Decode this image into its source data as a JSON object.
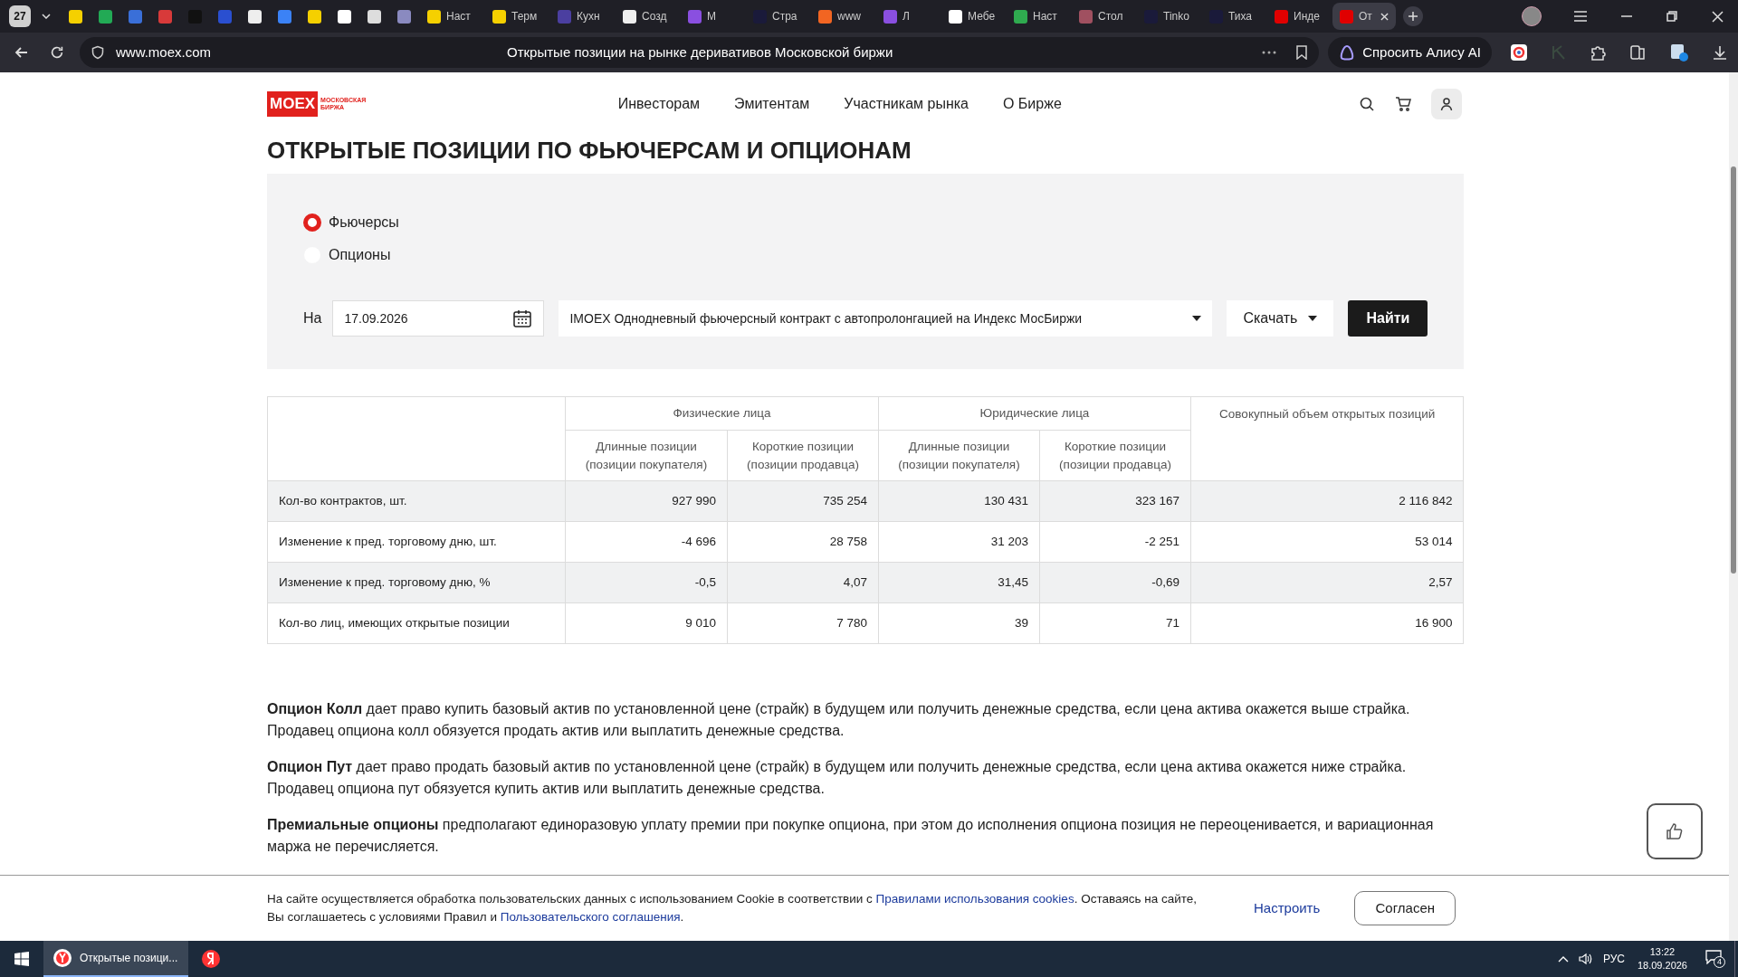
{
  "browser": {
    "tab_count": "27",
    "tabs": [
      {
        "color": "#f5d000",
        "selected": false
      },
      {
        "color": "#22aa55",
        "selected": false
      },
      {
        "color": "#3a6fd8",
        "selected": false
      },
      {
        "color": "#d83a3a",
        "selected": false
      },
      {
        "color": "#111111",
        "selected": false
      },
      {
        "color": "#2a4fd0",
        "selected": false
      },
      {
        "color": "#eeeeee",
        "selected": false
      },
      {
        "color": "#3b82f6",
        "selected": false
      },
      {
        "color": "#f5d000",
        "selected": false
      },
      {
        "color": "#ffffff",
        "selected": false
      },
      {
        "color": "#dddddd",
        "selected": false
      },
      {
        "color": "#8a8ac0",
        "selected": false
      },
      {
        "label": "Наст",
        "color": "#f5d000",
        "selected": false
      },
      {
        "label": "Терм",
        "color": "#f5d000",
        "selected": false
      },
      {
        "label": "Кухн",
        "color": "#4b3fa0",
        "selected": false
      },
      {
        "label": "Созд",
        "color": "#eeeeee",
        "selected": false
      },
      {
        "label": "М",
        "color": "#8a4fe0",
        "selected": false
      },
      {
        "label": "Стра",
        "color": "#1a1a3a",
        "selected": false
      },
      {
        "label": "www",
        "color": "#f26522",
        "selected": false
      },
      {
        "label": "Л",
        "color": "#8a4fe0",
        "selected": false
      },
      {
        "label": "Мебе",
        "color": "#ffffff",
        "selected": false
      },
      {
        "label": "Наст",
        "color": "#2faa4f",
        "selected": false
      },
      {
        "label": "Стол",
        "color": "#a05060",
        "selected": false
      },
      {
        "label": "Tinko",
        "color": "#1a1a3a",
        "selected": false
      },
      {
        "label": "Тиха",
        "color": "#1a1a3a",
        "selected": false
      },
      {
        "label": "Инде",
        "color": "#e00000",
        "selected": false
      },
      {
        "label": "От",
        "color": "#e00000",
        "selected": true
      }
    ],
    "address": "www.moex.com",
    "page_title": "Открытые позиции на рынке деривативов Московской биржи",
    "assistant_button": "Спросить Алису AI"
  },
  "site": {
    "logo": "MOEX",
    "logo_caption": "МОСКОВСКАЯ БИРЖА",
    "nav": [
      "Инвесторам",
      "Эмитентам",
      "Участникам рынка",
      "О Бирже"
    ]
  },
  "heading": "ОТКРЫТЫЕ ПОЗИЦИИ ПО ФЬЮЧЕРСАМ И ОПЦИОНАМ",
  "filter": {
    "types": [
      {
        "label": "Фьючерсы",
        "selected": true
      },
      {
        "label": "Опционы",
        "selected": false
      }
    ],
    "date_label": "На",
    "date": "17.09.2026",
    "contract": "IMOEX Однодневный фьючерсный контракт с автопролонгацией на Индекс МосБиржи",
    "download": "Скачать",
    "search": "Найти"
  },
  "table": {
    "groups": [
      "Физические лица",
      "Юридические лица",
      "Совокупный объем открытых позиций"
    ],
    "subcolumns": [
      "Длинные позиции (позиции покупателя)",
      "Короткие позиции (позиции продавца)",
      "Длинные позиции (позиции покупателя)",
      "Короткие позиции (позиции продавца)"
    ],
    "rows": [
      [
        "Кол-во контрактов, шт.",
        "927 990",
        "735 254",
        "130 431",
        "323 167",
        "2 116 842"
      ],
      [
        "Изменение к пред. торговому дню, шт.",
        "-4 696",
        "28 758",
        "31 203",
        "-2 251",
        "53 014"
      ],
      [
        "Изменение к пред. торговому дню, %",
        "-0,5",
        "4,07",
        "31,45",
        "-0,69",
        "2,57"
      ],
      [
        "Кол-во лиц, имеющих открытые позиции",
        "9 010",
        "7 780",
        "39",
        "71",
        "16 900"
      ]
    ]
  },
  "paragraphs": [
    "**Опцион Колл** дает право купить базовый актив по установленной цене (страйк) в будущем или получить денежные средства, если цена актива окажется выше страйка. Продавец опциона колл обязуется продать актив или выплатить денежные средства.",
    "**Опцион Пут** дает право продать базовый актив по установленной цене (страйк) в будущем или получить денежные средства, если цена актива окажется ниже страйка. Продавец опциона пут обязуется купить актив или выплатить денежные средства.",
    "**Премиальные опционы** предполагают единоразовую уплату премии при покупке опциона, при этом до исполнения опциона позиция не переоценивается, и вариационная маржа не перечисляется."
  ],
  "cookie": {
    "parts": [
      {
        "kind": "text",
        "text": "На сайте осуществляется обработка пользовательских данных с использованием Cookie в соответствии с "
      },
      {
        "kind": "link",
        "text": "Правилами использования cookies"
      },
      {
        "kind": "text",
        "text": ". Оставаясь на сайте, Вы соглашаетесь с условиями Правил и "
      },
      {
        "kind": "link",
        "text": "Пользовательского соглашения"
      },
      {
        "kind": "text",
        "text": "."
      }
    ],
    "settings": "Настроить",
    "accept": "Согласен"
  },
  "taskbar": {
    "app": "Открытые позици...",
    "language": "РУС",
    "time": "13:22",
    "date": "18.09.2026",
    "notifications": "4"
  }
}
